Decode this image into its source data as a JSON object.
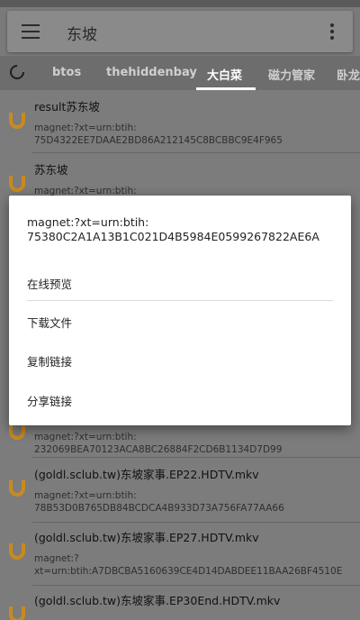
{
  "search": {
    "query": "东坡"
  },
  "tabs": [
    "btos",
    "thehiddenbay",
    "大白菜",
    "磁力管家",
    "卧龙"
  ],
  "active_tab": 2,
  "results": [
    {
      "title": "result苏东坡",
      "sub": "magnet:?xt=urn:btih:",
      "sub2": "75D4322EE7DAAE2BD86A212145C8BCBBC9E4F965"
    },
    {
      "title": "苏东坡",
      "sub": "magnet:?xt=urn:btih:",
      "sub2": ""
    },
    {
      "title": "",
      "sub": "magnet:?xt=urn:btih:",
      "sub2": "232069BEA70123ACA8BC26884F2CD6B1134D7D99"
    },
    {
      "title": "(goldl.sclub.tw)东坡家事.EP22.HDTV.mkv",
      "sub": "magnet:?xt=urn:btih:",
      "sub2": "78B53D0B765DB84BCDCA4B933D73A756FA77AA66"
    },
    {
      "title": "(goldl.sclub.tw)东坡家事.EP27.HDTV.mkv",
      "sub": "magnet:?",
      "sub2": "xt=urn:btih:A7DBCBA5160639CE4D14DABDEE11BAA26BF4510E"
    },
    {
      "title": "(goldl.sclub.tw)东坡家事.EP30End.HDTV.mkv",
      "sub": "",
      "sub2": ""
    }
  ],
  "dialog": {
    "title_line1": "magnet:?xt=urn:btih:",
    "title_line2": "75380C2A1A13B1C021D4B5984E0599267822AE6A",
    "items": [
      "在线预览",
      "下载文件",
      "复制链接",
      "分享链接"
    ]
  },
  "colors": {
    "accent_icon": "#c98a1e",
    "scrim": "#7a7a7a"
  }
}
